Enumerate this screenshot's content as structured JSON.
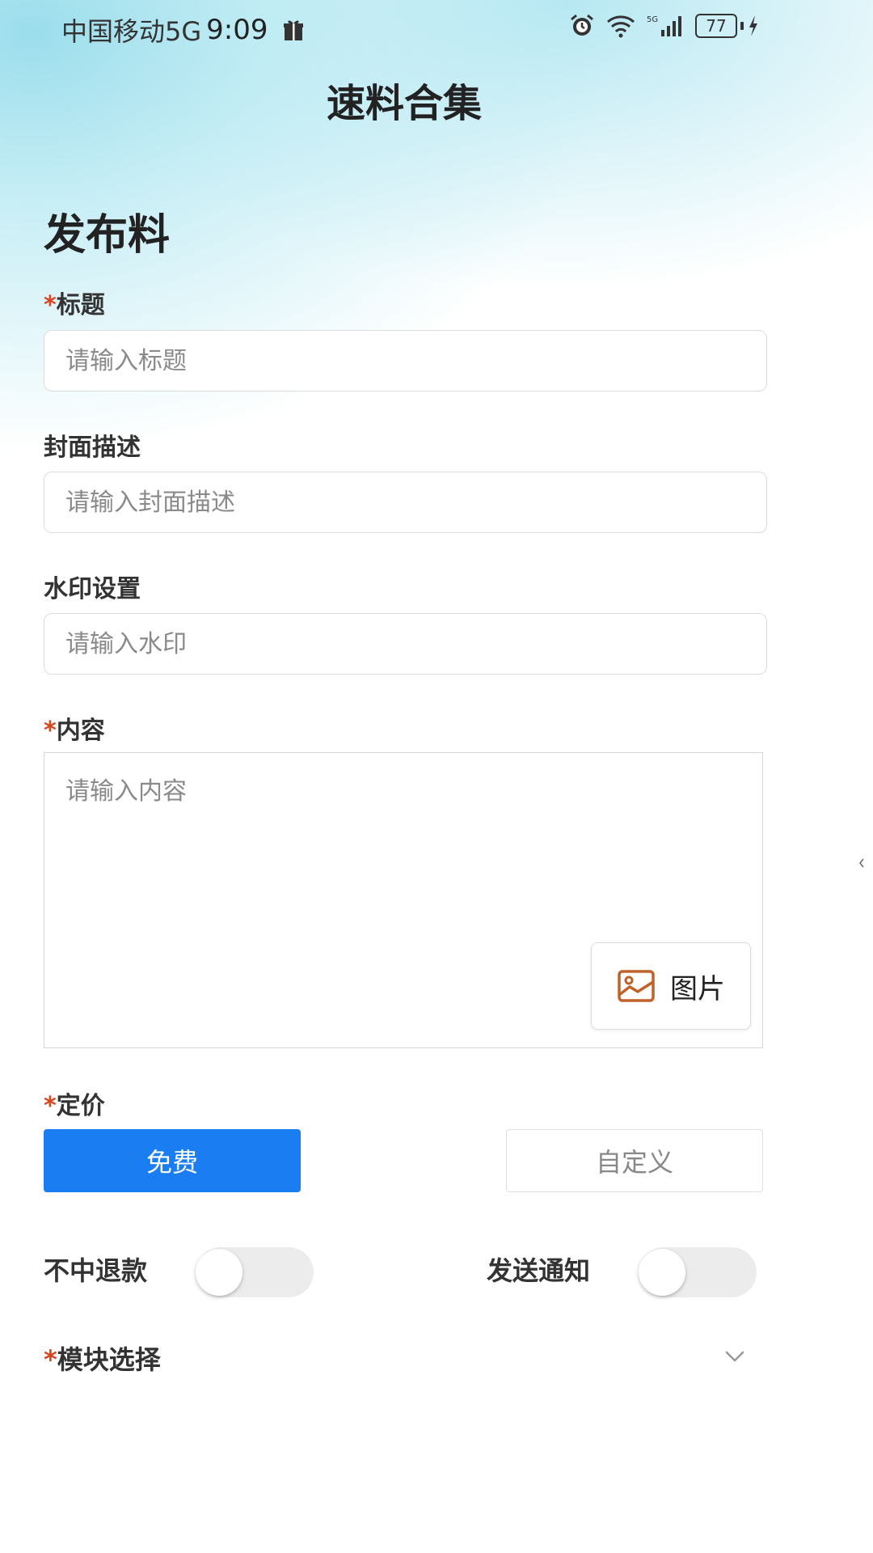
{
  "status_bar": {
    "carrier": "中国移动5G",
    "time": "9:09",
    "battery": "77"
  },
  "header": {
    "app_title": "速料合集"
  },
  "page": {
    "title": "发布料"
  },
  "form": {
    "title_field": {
      "required_mark": "*",
      "label": "标题",
      "placeholder": "请输入标题",
      "value": ""
    },
    "cover_field": {
      "label": "封面描述",
      "placeholder": "请输入封面描述",
      "value": ""
    },
    "watermark_field": {
      "label": "水印设置",
      "placeholder": "请输入水印",
      "value": ""
    },
    "content_field": {
      "required_mark": "*",
      "label": "内容",
      "placeholder": "请输入内容",
      "value": "",
      "image_button_label": "图片"
    },
    "pricing": {
      "required_mark": "*",
      "label": "定价",
      "options": [
        "免费",
        "自定义"
      ],
      "selected": "免费"
    },
    "no_win_refund": {
      "label": "不中退款",
      "enabled": false
    },
    "send_notification": {
      "label": "发送通知",
      "enabled": false
    },
    "module_select": {
      "required_mark": "*",
      "label": "模块选择"
    }
  },
  "colors": {
    "accent": "#1a7ef2",
    "required": "#d9461e",
    "image_icon": "#c0622a"
  }
}
